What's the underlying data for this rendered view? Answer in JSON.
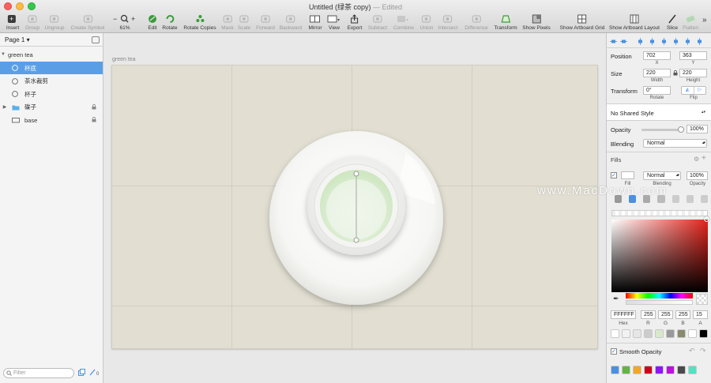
{
  "window": {
    "title": "Untitled (绿茶 copy)",
    "separator": "—",
    "status": "Edited"
  },
  "toolbar": {
    "items": [
      {
        "label": "Insert",
        "enabled": true,
        "icon": "insert-icon"
      },
      {
        "label": "Group",
        "enabled": false,
        "icon": "group-icon"
      },
      {
        "label": "Ungroup",
        "enabled": false,
        "icon": "ungroup-icon"
      },
      {
        "label": "Create Symbol",
        "enabled": false,
        "icon": "symbol-icon"
      },
      {
        "label": "61%",
        "enabled": true,
        "icon": "zoom-icon"
      },
      {
        "label": "Edit",
        "enabled": true,
        "icon": "edit-icon"
      },
      {
        "label": "Rotate",
        "enabled": true,
        "icon": "rotate-icon"
      },
      {
        "label": "Rotate Copies",
        "enabled": true,
        "icon": "rotate-copies-icon"
      },
      {
        "label": "Mask",
        "enabled": false,
        "icon": "mask-icon"
      },
      {
        "label": "Scale",
        "enabled": false,
        "icon": "scale-icon"
      },
      {
        "label": "Forward",
        "enabled": false,
        "icon": "forward-icon"
      },
      {
        "label": "Backward",
        "enabled": false,
        "icon": "backward-icon"
      },
      {
        "label": "Mirror",
        "enabled": true,
        "icon": "mirror-icon"
      },
      {
        "label": "View",
        "enabled": true,
        "icon": "view-icon"
      },
      {
        "label": "Export",
        "enabled": true,
        "icon": "export-icon"
      },
      {
        "label": "Subtract",
        "enabled": false,
        "icon": "subtract-icon"
      },
      {
        "label": "Combine",
        "enabled": false,
        "icon": "combine-icon"
      },
      {
        "label": "Union",
        "enabled": false,
        "icon": "union-icon"
      },
      {
        "label": "Intersect",
        "enabled": false,
        "icon": "intersect-icon"
      },
      {
        "label": "Difference",
        "enabled": false,
        "icon": "difference-icon"
      },
      {
        "label": "Transform",
        "enabled": true,
        "icon": "transform-icon"
      },
      {
        "label": "Show Pixels",
        "enabled": true,
        "icon": "pixels-icon"
      },
      {
        "label": "Show Artboard Grid",
        "enabled": true,
        "icon": "grid-icon"
      },
      {
        "label": "Show Artboard Layout",
        "enabled": true,
        "icon": "layout-icon"
      },
      {
        "label": "Slice",
        "enabled": true,
        "icon": "slice-icon"
      },
      {
        "label": "Flatten",
        "enabled": false,
        "icon": "flatten-icon"
      }
    ]
  },
  "pages": {
    "current": "Page 1"
  },
  "layers": {
    "artboard_name": "green tea",
    "items": [
      {
        "name": "杯底",
        "kind": "oval",
        "selected": true,
        "locked": false
      },
      {
        "name": "茶水裁剪",
        "kind": "oval",
        "selected": false,
        "locked": false
      },
      {
        "name": "杯子",
        "kind": "oval",
        "selected": false,
        "locked": false
      },
      {
        "name": "碟子",
        "kind": "folder",
        "selected": false,
        "locked": true
      },
      {
        "name": "base",
        "kind": "rect",
        "selected": false,
        "locked": true
      }
    ],
    "filter_placeholder": "Filter"
  },
  "canvas": {
    "artboard_label": "green tea"
  },
  "inspector": {
    "position_label": "Position",
    "position_x": "702",
    "position_y": "363",
    "x_label": "X",
    "y_label": "Y",
    "size_label": "Size",
    "width": "220",
    "height": "220",
    "width_label": "Width",
    "height_label": "Height",
    "transform_label": "Transform",
    "rotate_value": "0°",
    "rotate_label": "Rotate",
    "flip_label": "Flip",
    "shared_style": "No Shared Style",
    "opacity_label": "Opacity",
    "opacity_value": "100%",
    "opacity_level": 1.0,
    "blending_label": "Blending",
    "blending_value": "Normal",
    "fills_label": "Fills",
    "fill_blending": "Normal",
    "fill_opacity": "100%",
    "fill_sub_fill": "Fill",
    "fill_sub_blending": "Blending",
    "fill_sub_opacity": "Opacity",
    "hex_value": "FFFFFF",
    "r_value": "255",
    "g_value": "255",
    "b_value": "255",
    "a_value": "15",
    "hex_label": "Hex",
    "r_label": "R",
    "g_label": "G",
    "b_label": "B",
    "a_label": "A",
    "smooth_opacity_label": "Smooth Opacity",
    "preset_colors": [
      "#ffffff",
      "#f2f2f2",
      "#e6e6e6",
      "#cccccc",
      "#d7e9c9",
      "#999999",
      "#8a8a6e",
      "#ffffff",
      "#000000"
    ],
    "document_colors": [
      "#4a90e2",
      "#63b443",
      "#f5a623",
      "#d0021b",
      "#9013fe",
      "#bd10e0",
      "#4a4a4a",
      "#50e3c2"
    ]
  },
  "watermark": "www.MacDown.com",
  "colors": {
    "selection": "#5a9fe6",
    "accent": "#4a90e2",
    "tea_green": "#cfe7c2",
    "artboard_bg": "#e2dfd2"
  }
}
